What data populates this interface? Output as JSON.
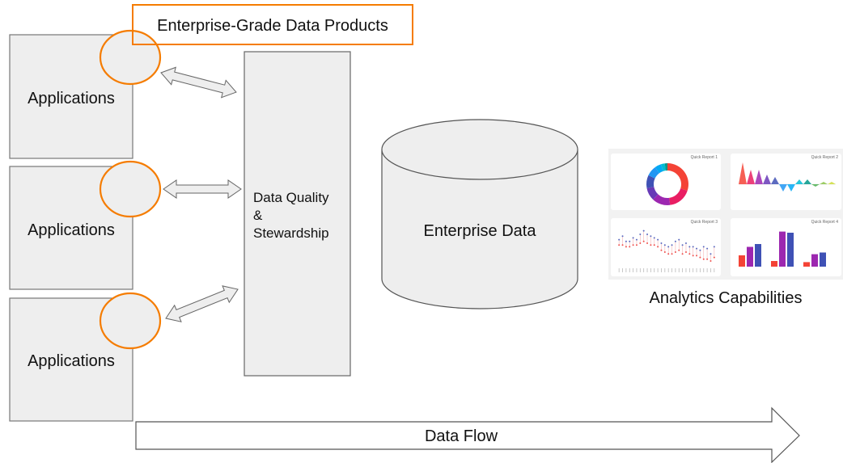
{
  "title_box": {
    "label": "Enterprise-Grade Data Products"
  },
  "applications": [
    {
      "label": "Applications"
    },
    {
      "label": "Applications"
    },
    {
      "label": "Applications"
    }
  ],
  "data_quality": {
    "lines": [
      "Data Quality",
      "&",
      "Stewardship"
    ]
  },
  "enterprise_data": {
    "label": "Enterprise Data"
  },
  "analytics": {
    "caption": "Analytics Capabilities",
    "reports": [
      {
        "title": "Quick Report 1",
        "type": "donut",
        "slices": [
          30,
          18,
          14,
          10,
          10,
          8,
          5,
          3,
          2
        ],
        "colors": [
          "#f44336",
          "#e91e63",
          "#9c27b0",
          "#673ab7",
          "#3f51b5",
          "#2196f3",
          "#03a9f4",
          "#00bcd4",
          "#009688"
        ]
      },
      {
        "title": "Quick Report 2",
        "type": "area-peaks",
        "values": [
          9,
          6,
          6,
          4,
          3,
          -3,
          -3,
          2,
          2,
          -1,
          1,
          1
        ],
        "colors": [
          "#f44336",
          "#e91e63",
          "#9c27b0",
          "#673ab7",
          "#3f51b5",
          "#2196f3",
          "#03a9f4",
          "#00bcd4",
          "#009688",
          "#4caf50",
          "#8bc34a",
          "#cddc39"
        ]
      },
      {
        "title": "Quick Report 3",
        "type": "dumbbell",
        "high": [
          7,
          9,
          6,
          6,
          8,
          7,
          10,
          12,
          10,
          9,
          8,
          7,
          5,
          4,
          3,
          4,
          6,
          7,
          4,
          5,
          3,
          3,
          2,
          1,
          3,
          2,
          -1,
          3
        ],
        "low": [
          4,
          4,
          3,
          3,
          4,
          4,
          5,
          6,
          5,
          4,
          4,
          3,
          1,
          0,
          -1,
          -1,
          0,
          1,
          -1,
          0,
          -1,
          -2,
          -2,
          -3,
          -4,
          -4,
          -5,
          -3
        ]
      },
      {
        "title": "Quick Report 4",
        "type": "bar",
        "groups": [
          [
            20,
            35,
            40
          ],
          [
            10,
            62,
            60
          ],
          [
            8,
            22,
            25
          ]
        ],
        "colors": [
          "#f44336",
          "#9c27b0",
          "#3f51b5"
        ]
      }
    ]
  },
  "data_flow": {
    "label": "Data Flow"
  },
  "colors": {
    "accent": "#f57c00",
    "box_fill": "#eeeeee",
    "stroke": "#666666"
  }
}
